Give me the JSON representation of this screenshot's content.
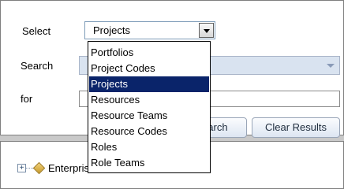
{
  "form": {
    "select_label": "Select",
    "select_value": "Projects",
    "search_label": "Search",
    "search_value": "",
    "for_label": "for",
    "for_value": "",
    "search_button": "Search",
    "clear_button": "Clear Results"
  },
  "dropdown": {
    "items": [
      {
        "label": "Portfolios",
        "selected": false
      },
      {
        "label": "Project Codes",
        "selected": false
      },
      {
        "label": "Projects",
        "selected": true
      },
      {
        "label": "Resources",
        "selected": false
      },
      {
        "label": "Resource Teams",
        "selected": false
      },
      {
        "label": "Resource Codes",
        "selected": false
      },
      {
        "label": "Roles",
        "selected": false
      },
      {
        "label": "Role Teams",
        "selected": false
      }
    ]
  },
  "tree": {
    "root_label": "Enterprise",
    "expander": "+",
    "icon": "diamond-icon"
  }
}
